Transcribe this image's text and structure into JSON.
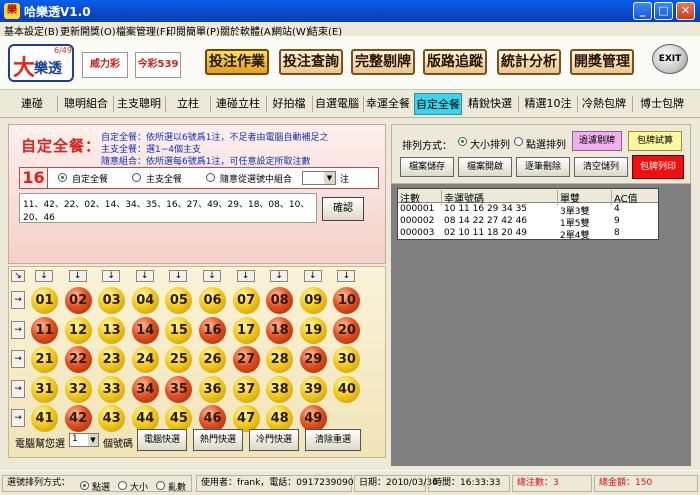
{
  "window": {
    "title": "哈樂透V1.0"
  },
  "menu": [
    "基本設定(B)",
    "更新開獎(O)",
    "檔案管理(F)",
    "印閱簡單(P)",
    "關於軟體(A)",
    "網站(W)",
    "結束(E)"
  ],
  "logos": {
    "main_big": "大",
    "main_text": "樂透",
    "main_sup": "6/49",
    "second": "威力彩",
    "third": "今彩539"
  },
  "main_buttons": [
    "投注作業",
    "投注查詢",
    "完整剔牌",
    "版路追蹤",
    "統計分析",
    "開獎管理"
  ],
  "exit_label": "EXIT",
  "tabs": [
    "連碰",
    "聰明組合",
    "主支聰明",
    "立柱",
    "連碰立柱",
    "好拍檔",
    "自選電腦",
    "幸運全餐",
    "自定全餐",
    "精銳快選",
    "精選10注",
    "冷熱包牌",
    "博士包牌"
  ],
  "panel": {
    "title": "自定全餐：",
    "help": [
      "自定全餐：依所選以6號爲1注，不足者由電腦自動補足之",
      "主支全餐：選1~4個主支",
      "隨意組合：依所選每6號爲1注，可任意設定所取注數"
    ],
    "count": "16",
    "options": [
      "自定全餐",
      "主支全餐",
      "隨意從選號中組合"
    ],
    "unit": "注",
    "selected_numbers": "11、42、22、02、14、34、35、16、27、49、29、18、08、10、20、46",
    "confirm_label": "確認"
  },
  "grid": {
    "rows": [
      [
        {
          "n": "01",
          "c": "y"
        },
        {
          "n": "02",
          "c": "r"
        },
        {
          "n": "03",
          "c": "y"
        },
        {
          "n": "04",
          "c": "y"
        },
        {
          "n": "05",
          "c": "y"
        },
        {
          "n": "06",
          "c": "y"
        },
        {
          "n": "07",
          "c": "y"
        },
        {
          "n": "08",
          "c": "r"
        },
        {
          "n": "09",
          "c": "y"
        },
        {
          "n": "10",
          "c": "r"
        }
      ],
      [
        {
          "n": "11",
          "c": "r"
        },
        {
          "n": "12",
          "c": "y"
        },
        {
          "n": "13",
          "c": "y"
        },
        {
          "n": "14",
          "c": "r"
        },
        {
          "n": "15",
          "c": "y"
        },
        {
          "n": "16",
          "c": "r"
        },
        {
          "n": "17",
          "c": "y"
        },
        {
          "n": "18",
          "c": "r"
        },
        {
          "n": "19",
          "c": "y"
        },
        {
          "n": "20",
          "c": "r"
        }
      ],
      [
        {
          "n": "21",
          "c": "y"
        },
        {
          "n": "22",
          "c": "r"
        },
        {
          "n": "23",
          "c": "y"
        },
        {
          "n": "24",
          "c": "y"
        },
        {
          "n": "25",
          "c": "y"
        },
        {
          "n": "26",
          "c": "y"
        },
        {
          "n": "27",
          "c": "r"
        },
        {
          "n": "28",
          "c": "y"
        },
        {
          "n": "29",
          "c": "r"
        },
        {
          "n": "30",
          "c": "y"
        }
      ],
      [
        {
          "n": "31",
          "c": "y"
        },
        {
          "n": "32",
          "c": "y"
        },
        {
          "n": "33",
          "c": "y"
        },
        {
          "n": "34",
          "c": "r"
        },
        {
          "n": "35",
          "c": "r"
        },
        {
          "n": "36",
          "c": "y"
        },
        {
          "n": "37",
          "c": "y"
        },
        {
          "n": "38",
          "c": "y"
        },
        {
          "n": "39",
          "c": "y"
        },
        {
          "n": "40",
          "c": "y"
        }
      ],
      [
        {
          "n": "41",
          "c": "y"
        },
        {
          "n": "42",
          "c": "r"
        },
        {
          "n": "43",
          "c": "y"
        },
        {
          "n": "44",
          "c": "y"
        },
        {
          "n": "45",
          "c": "y"
        },
        {
          "n": "46",
          "c": "r"
        },
        {
          "n": "47",
          "c": "y"
        },
        {
          "n": "48",
          "c": "y"
        },
        {
          "n": "49",
          "c": "r"
        }
      ]
    ],
    "corner_arrow": "↘",
    "col_arrow": "↓",
    "row_arrow": "→",
    "auto_label": "電腦幫您選",
    "auto_value": "1",
    "auto_unit": "個號碼",
    "quick_buttons": [
      "電腦快選",
      "熱門快選",
      "冷門快選",
      "清除重選"
    ]
  },
  "right": {
    "sort_label": "排列方式：",
    "sort_options": [
      "大小排列",
      "點選排列"
    ],
    "pink_button": "過濾剔牌",
    "yellow_button": "包牌試算",
    "buttons": [
      "檔案儲存",
      "檔案開啟",
      "逐筆刪除",
      "清空儲列"
    ],
    "red_button": "包牌列印"
  },
  "results": {
    "headers": [
      "注數",
      "幸運號碼",
      "單雙",
      "AC值"
    ],
    "rows": [
      {
        "id": "000001",
        "nums": "10  11  16  29  34  35",
        "oe": "3單3雙",
        "ac": "4"
      },
      {
        "id": "000002",
        "nums": "08  14  22  27  42  46",
        "oe": "1單5雙",
        "ac": "9"
      },
      {
        "id": "000003",
        "nums": "02  10  11  18  20  49",
        "oe": "2單4雙",
        "ac": "8"
      }
    ]
  },
  "status": {
    "sort_label": "選號排列方式：",
    "sort_options": [
      "點選",
      "大小",
      "亂數"
    ],
    "user": "使用者：frank，電話：0917239090",
    "date": "日期：2010/03/30",
    "time": "時間：16:33:33",
    "total_bets": "總注數：3",
    "total_amount": "總金額：150"
  }
}
